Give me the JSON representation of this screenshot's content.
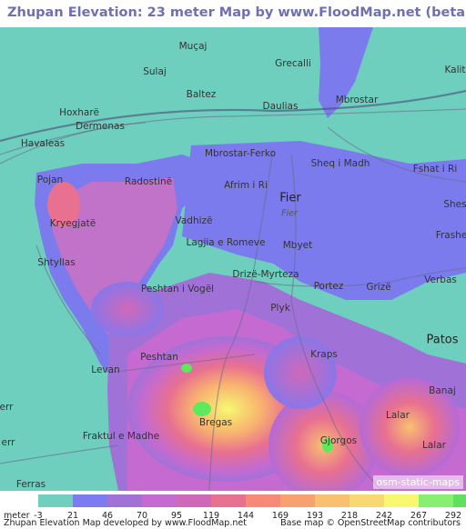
{
  "title": "Zhupan Elevation: 23 meter Map by www.FloodMap.net (beta)",
  "map": {
    "places": [
      {
        "name": "Muçaj"
      },
      {
        "name": "Sulaj"
      },
      {
        "name": "Grecalli"
      },
      {
        "name": "Kalit"
      },
      {
        "name": "Baltez"
      },
      {
        "name": "Daulias"
      },
      {
        "name": "Mbrostar"
      },
      {
        "name": "Hoxharë"
      },
      {
        "name": "Dermenas"
      },
      {
        "name": "Havaleas"
      },
      {
        "name": "Mbrostar-Ferko"
      },
      {
        "name": "Sheq i Madh"
      },
      {
        "name": "Fshat i Ri"
      },
      {
        "name": "Pojan"
      },
      {
        "name": "Radostinë"
      },
      {
        "name": "Afrim i Ri"
      },
      {
        "name": "Fier"
      },
      {
        "name": "Fier"
      },
      {
        "name": "Shes"
      },
      {
        "name": "Kryegjatë"
      },
      {
        "name": "Vadhizë"
      },
      {
        "name": "Lagjia e Romeve"
      },
      {
        "name": "Mbyet"
      },
      {
        "name": "Frashe"
      },
      {
        "name": "Shtyllas"
      },
      {
        "name": "Drizë-Myrteza"
      },
      {
        "name": "Verbas"
      },
      {
        "name": "Peshtan i Vogël"
      },
      {
        "name": "Portez"
      },
      {
        "name": "Grizë"
      },
      {
        "name": "Plyk"
      },
      {
        "name": "Patos"
      },
      {
        "name": "Peshtan"
      },
      {
        "name": "Kraps"
      },
      {
        "name": "Levan"
      },
      {
        "name": "Banaj"
      },
      {
        "name": "Bregas"
      },
      {
        "name": "Lalar"
      },
      {
        "name": "Fraktul e Madhe"
      },
      {
        "name": "Gjorgos"
      },
      {
        "name": "Lalar"
      },
      {
        "name": "Ferras"
      },
      {
        "name": "err"
      },
      {
        "name": "err"
      }
    ],
    "osm_credit": "osm-static-maps",
    "colors": {
      "sea_level": "#6fcfbf",
      "low": "#7b7bee",
      "mid": "#c073c8",
      "high": "#f4e26b",
      "peak": "#5ee85e"
    }
  },
  "legend": {
    "unit": "meter",
    "entries": [
      {
        "label": "-3",
        "color": "#6fd0c0"
      },
      {
        "label": "21",
        "color": "#7c7cf0"
      },
      {
        "label": "46",
        "color": "#a072d8"
      },
      {
        "label": "70",
        "color": "#c46ad0"
      },
      {
        "label": "95",
        "color": "#d068b8"
      },
      {
        "label": "119",
        "color": "#e87090"
      },
      {
        "label": "144",
        "color": "#f88878"
      },
      {
        "label": "169",
        "color": "#f8a070"
      },
      {
        "label": "193",
        "color": "#f8c070"
      },
      {
        "label": "218",
        "color": "#f8d870"
      },
      {
        "label": "242",
        "color": "#f8f870"
      },
      {
        "label": "267",
        "color": "#88f070"
      },
      {
        "label": "292",
        "color": "#60e060"
      }
    ],
    "footer_left": "Zhupan Elevation Map developed by www.FloodMap.net",
    "footer_right": "Base map © OpenStreetMap contributors"
  }
}
